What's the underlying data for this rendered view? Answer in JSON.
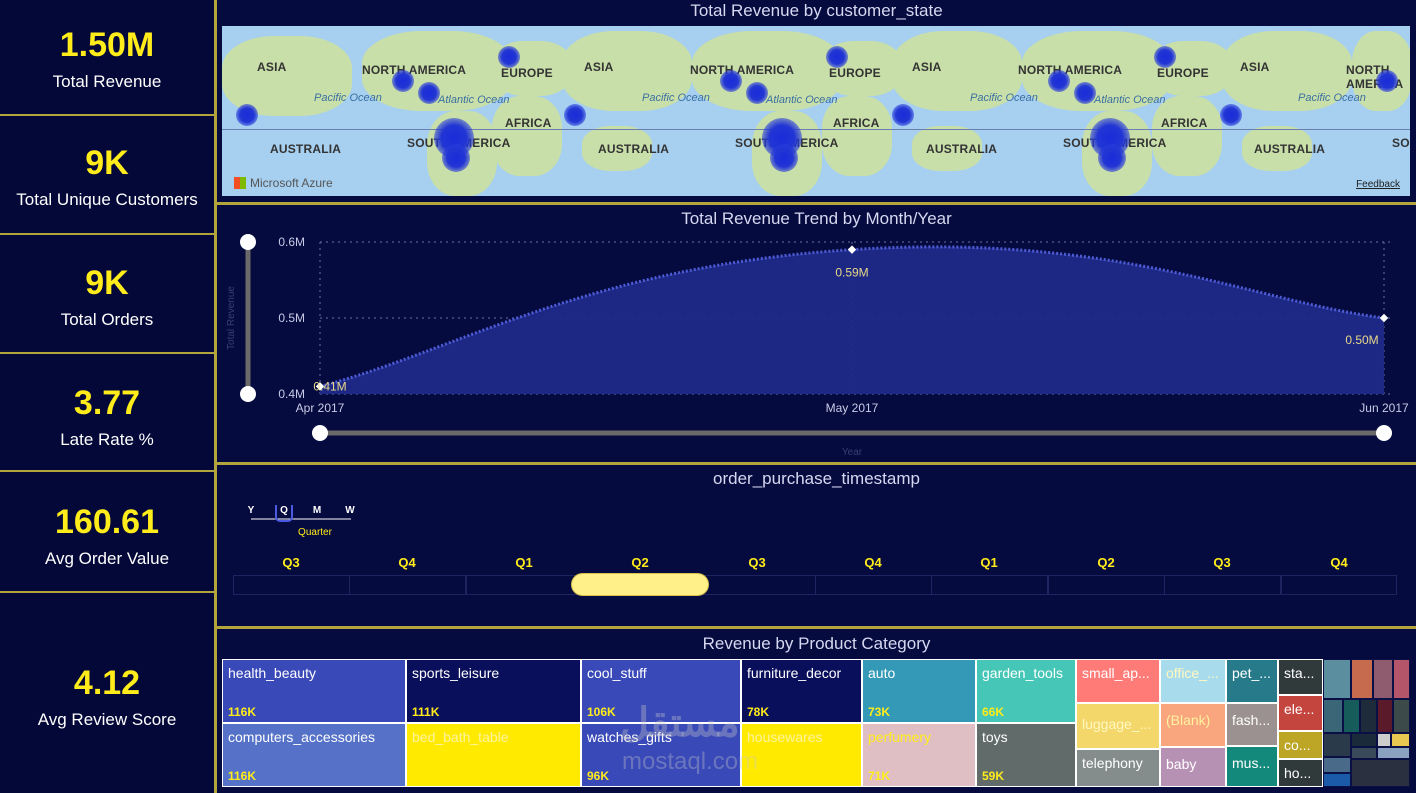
{
  "kpis": [
    {
      "value": "1.50M",
      "label": "Total Revenue"
    },
    {
      "value": "9K",
      "label": "Total Unique Customers"
    },
    {
      "value": "9K",
      "label": "Total Orders"
    },
    {
      "value": "3.77",
      "label": "Late Rate %"
    },
    {
      "value": "160.61",
      "label": "Avg Order Value"
    },
    {
      "value": "4.12",
      "label": "Avg Review Score"
    }
  ],
  "map": {
    "title": "Total Revenue by customer_state",
    "labels": [
      "ASIA",
      "NORTH AMERICA",
      "EUROPE",
      "ASIA",
      "NORTH AMERICA",
      "EUROPE",
      "ASIA",
      "NORTH AMERICA",
      "EUROPE",
      "ASIA",
      "NORTH AMERICA",
      "AFRICA",
      "AFRICA",
      "AFRICA",
      "AUSTRALIA",
      "SOUTH AMERICA",
      "AUSTRALIA",
      "SOUTH AMERICA",
      "AUSTRALIA",
      "SOUTH AMERICA",
      "AUSTRALIA",
      "SOU"
    ],
    "oceans": [
      "Pacific Ocean",
      "Atlantic Ocean",
      "Pacific Ocean",
      "Atlantic Ocean",
      "Pacific Ocean",
      "Atlantic Ocean",
      "Pacific Ocean"
    ],
    "attribution": "Microsoft Azure",
    "feedback": "Feedback"
  },
  "trend": {
    "title": "Total Revenue Trend by Month/Year",
    "yaxis_title": "Total Revenue",
    "xaxis_title": "Year"
  },
  "chart_data": {
    "type": "area",
    "x": [
      "Apr 2017",
      "May 2017",
      "Jun 2017"
    ],
    "values": [
      0.41,
      0.59,
      0.5
    ],
    "data_labels": [
      "0.41M",
      "0.59M",
      "0.50M"
    ],
    "yticks": [
      "0.6M",
      "0.5M",
      "0.4M"
    ],
    "ylim": [
      0.4,
      0.6
    ],
    "ylabel": "Total Revenue",
    "xlabel": "Year",
    "grid": true,
    "color": "#2b3494"
  },
  "slicer": {
    "title": "order_purchase_timestamp",
    "granularity": [
      "Y",
      "Q",
      "M",
      "W"
    ],
    "granularity_selected": "Q",
    "granularity_label": "Quarter",
    "quarters": [
      "Q3",
      "Q4",
      "Q1",
      "Q2",
      "Q3",
      "Q4",
      "Q1",
      "Q2",
      "Q3",
      "Q4"
    ]
  },
  "treemap": {
    "title": "Revenue by Product Category",
    "tiles": [
      {
        "name": "health_beauty",
        "value": "116K",
        "color": "#3949b8"
      },
      {
        "name": "computers_accessories",
        "value": "116K",
        "color": "#5572c8"
      },
      {
        "name": "sports_leisure",
        "value": "111K",
        "color": "#0a0f5c"
      },
      {
        "name": "bed_bath_table",
        "value": "",
        "color": "#ffea00"
      },
      {
        "name": "cool_stuff",
        "value": "106K",
        "color": "#3949b8"
      },
      {
        "name": "watches_gifts",
        "value": "96K",
        "color": "#3949b8"
      },
      {
        "name": "furniture_decor",
        "value": "78K",
        "color": "#0a0f5c"
      },
      {
        "name": "housewares",
        "value": "",
        "color": "#ffea00"
      },
      {
        "name": "auto",
        "value": "73K",
        "color": "#3399b6"
      },
      {
        "name": "perfumery",
        "value": "71K",
        "color": "#dfbfc3"
      },
      {
        "name": "garden_tools",
        "value": "66K",
        "color": "#45c6b6"
      },
      {
        "name": "toys",
        "value": "59K",
        "color": "#606b6a"
      },
      {
        "name": "small_ap...",
        "value": "",
        "color": "#ff7b77"
      },
      {
        "name": "luggage_...",
        "value": "",
        "color": "#f3d76a"
      },
      {
        "name": "telephony",
        "value": "",
        "color": "#848d8c"
      },
      {
        "name": "office_...",
        "value": "",
        "color": "#a8dcec"
      },
      {
        "name": "(Blank)",
        "value": "",
        "color": "#f9a57d"
      },
      {
        "name": "baby",
        "value": "",
        "color": "#b791b4"
      },
      {
        "name": "pet_...",
        "value": "",
        "color": "#267a8a"
      },
      {
        "name": "fash...",
        "value": "",
        "color": "#9b9191"
      },
      {
        "name": "mus...",
        "value": "",
        "color": "#13897b"
      },
      {
        "name": "sta...",
        "value": "",
        "color": "#313a3a"
      },
      {
        "name": "ele...",
        "value": "",
        "color": "#c4453d"
      },
      {
        "name": "co...",
        "value": "",
        "color": "#bda526"
      },
      {
        "name": "ho...",
        "value": "",
        "color": "#313a3a"
      }
    ]
  },
  "watermark": {
    "arabic": "مستقل",
    "latin": "mostaql.com"
  }
}
